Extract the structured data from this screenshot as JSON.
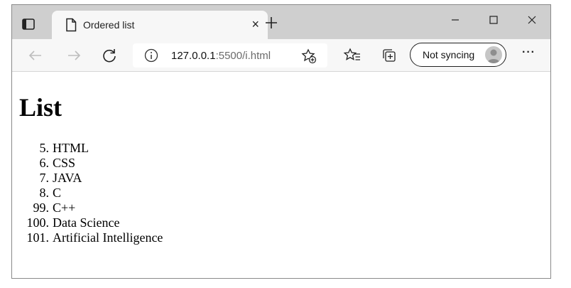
{
  "browser": {
    "tab": {
      "title": "Ordered list",
      "close_glyph": "×"
    },
    "new_tab_icon": "plus-icon",
    "address": {
      "host": "127.0.0.1",
      "path": ":5500/i.html"
    },
    "sync_label": "Not syncing",
    "more_label": "···"
  },
  "page": {
    "heading": "List",
    "items": [
      {
        "num": "5.",
        "text": "HTML"
      },
      {
        "num": "6.",
        "text": "CSS"
      },
      {
        "num": "7.",
        "text": "JAVA"
      },
      {
        "num": "8.",
        "text": "C"
      },
      {
        "num": "99.",
        "text": "C++"
      },
      {
        "num": "100.",
        "text": "Data Science"
      },
      {
        "num": "101.",
        "text": "Artificial Intelligence"
      }
    ]
  },
  "colors": {
    "titlebar": "#cfcfcf",
    "toolbar": "#f7f7f7",
    "tab": "#f7f7f7"
  }
}
